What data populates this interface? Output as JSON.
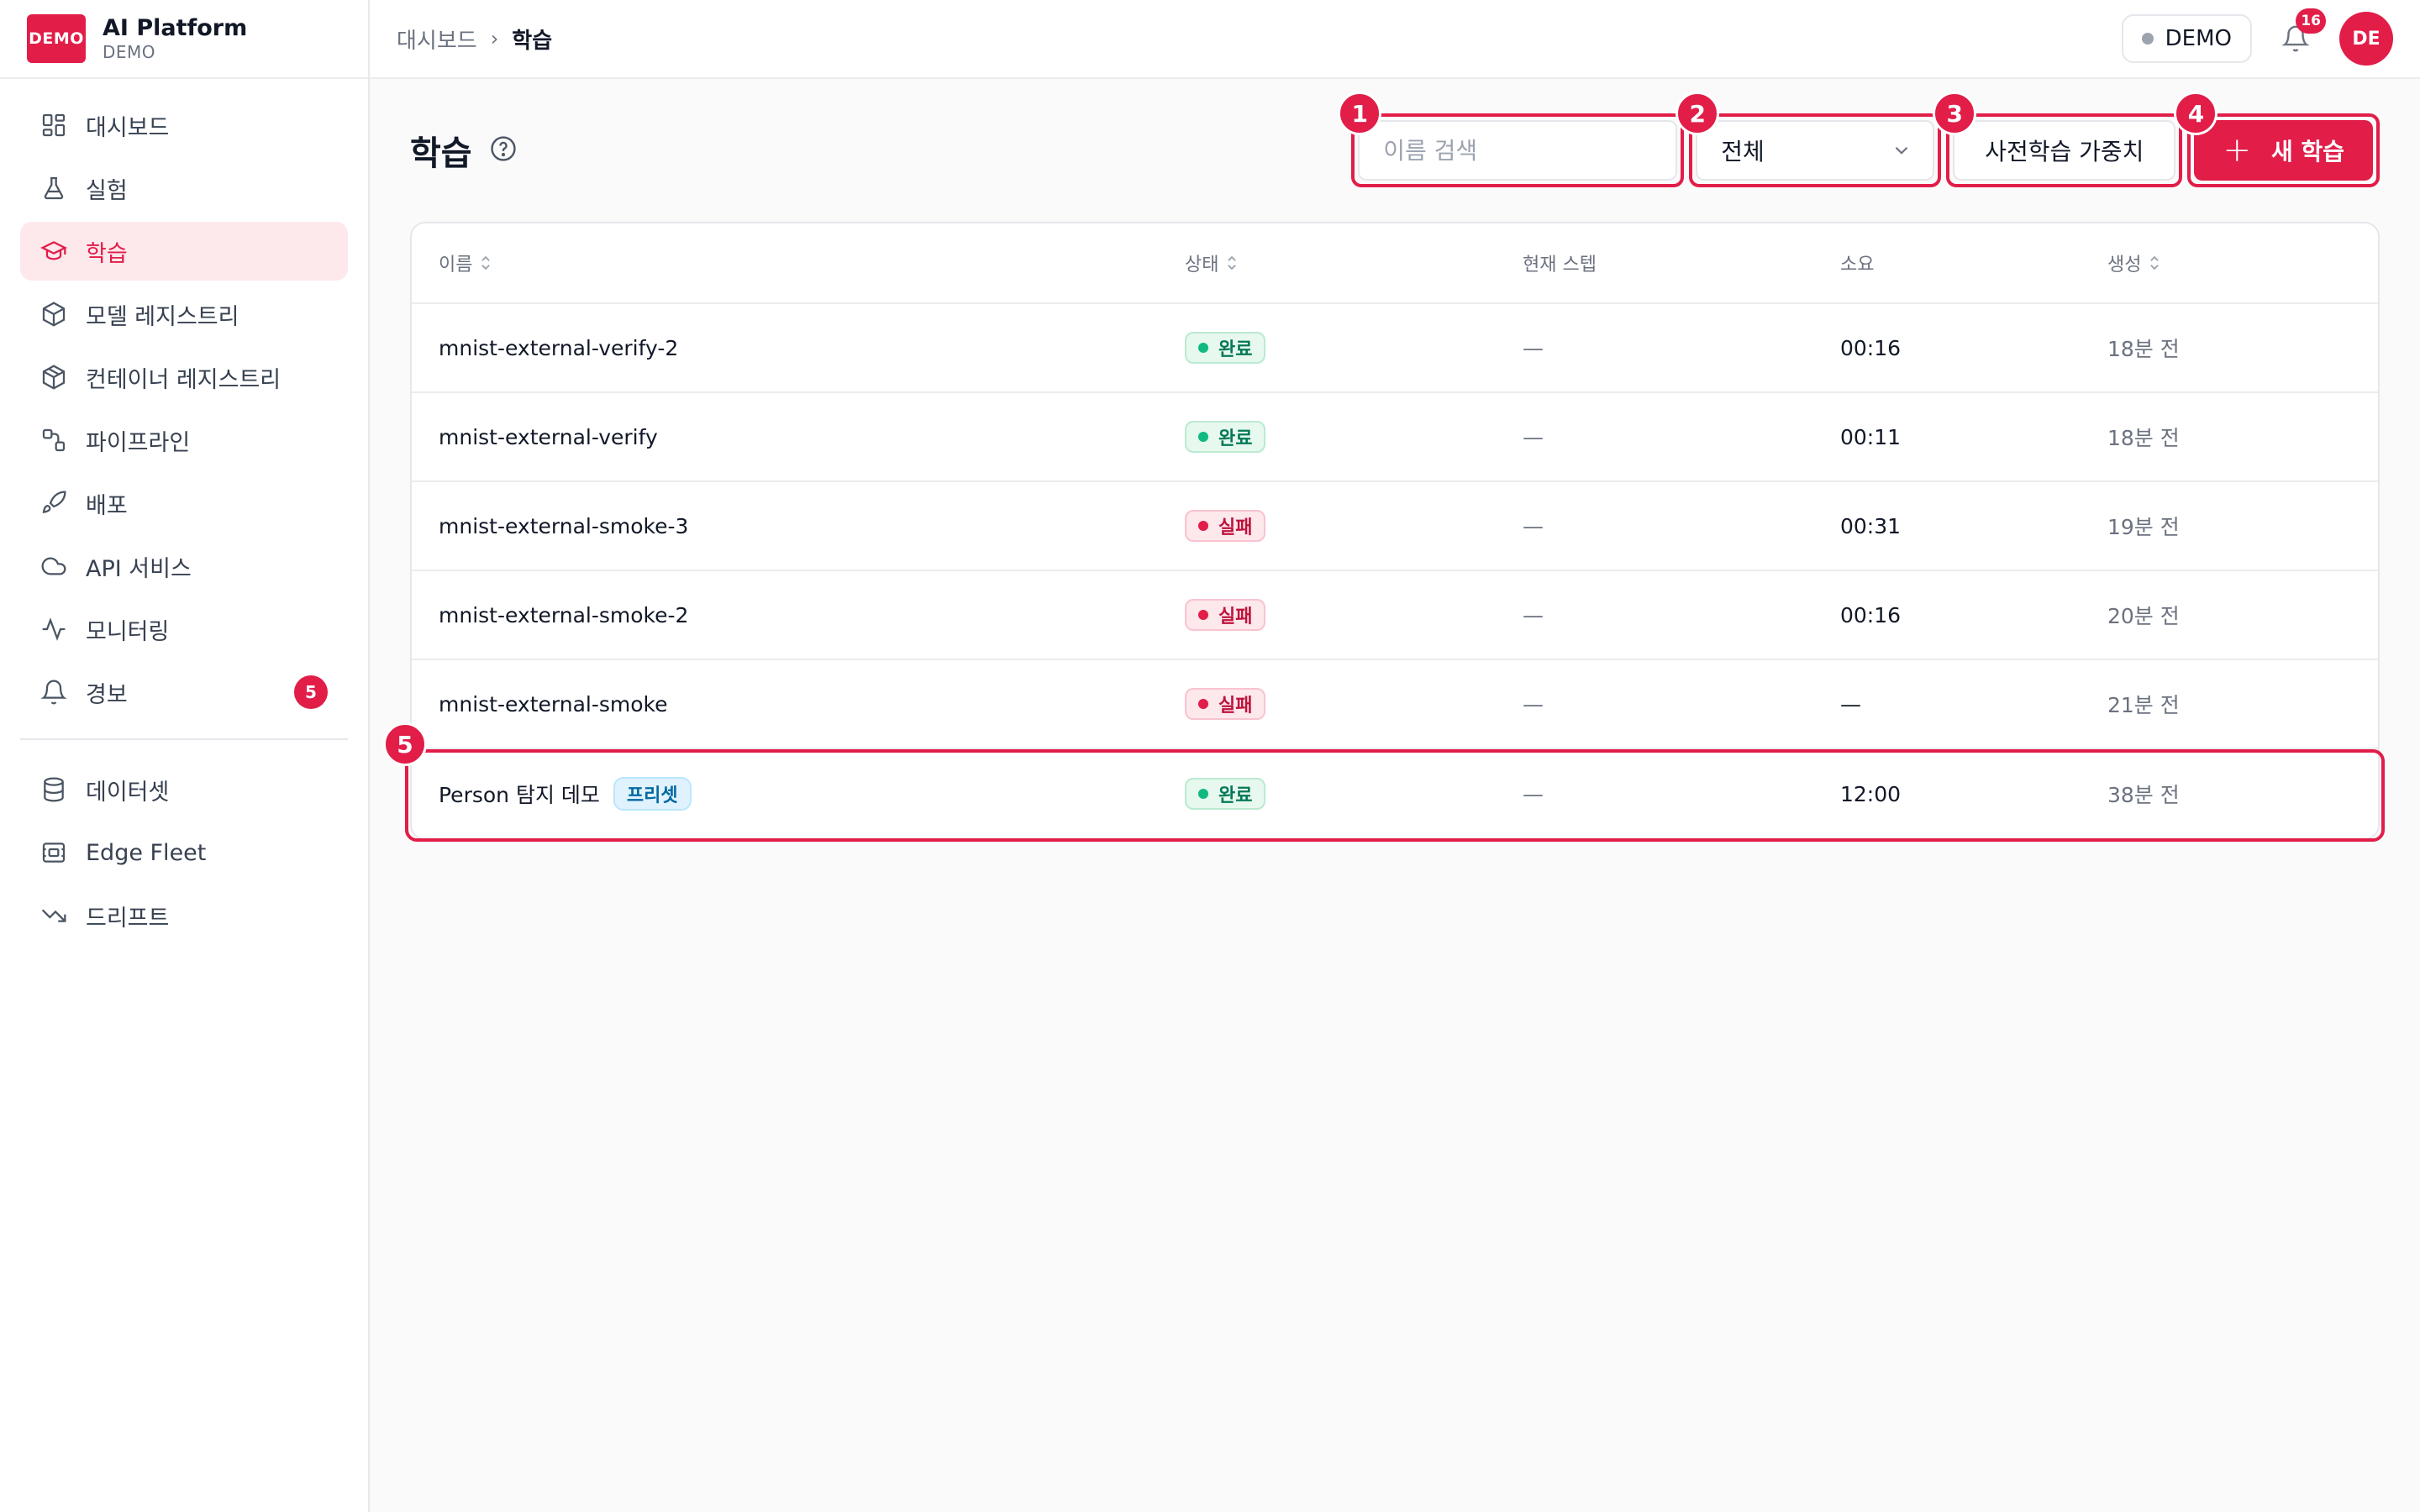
{
  "brand": {
    "logo": "DEMO",
    "title": "AI Platform",
    "subtitle": "DEMO"
  },
  "sidebar": {
    "items": [
      {
        "label": "대시보드",
        "icon": "dashboard-icon"
      },
      {
        "label": "실험",
        "icon": "flask-icon"
      },
      {
        "label": "학습",
        "icon": "graduation-cap-icon",
        "active": true
      },
      {
        "label": "모델 레지스트리",
        "icon": "cube-icon"
      },
      {
        "label": "컨테이너 레지스트리",
        "icon": "box-icon"
      },
      {
        "label": "파이프라인",
        "icon": "pipeline-icon"
      },
      {
        "label": "배포",
        "icon": "rocket-icon"
      },
      {
        "label": "API 서비스",
        "icon": "cloud-icon"
      },
      {
        "label": "모니터링",
        "icon": "activity-icon"
      },
      {
        "label": "경보",
        "icon": "bell-icon",
        "badge": "5"
      }
    ],
    "items2": [
      {
        "label": "데이터셋",
        "icon": "database-icon"
      },
      {
        "label": "Edge Fleet",
        "icon": "edge-device-icon"
      },
      {
        "label": "드리프트",
        "icon": "trending-down-icon"
      }
    ]
  },
  "topbar": {
    "breadcrumb": [
      "대시보드",
      "학습"
    ],
    "env": "DEMO",
    "notifications": "16",
    "avatar": "DE"
  },
  "page": {
    "title": "학습",
    "search_placeholder": "이름 검색",
    "filter_value": "전체",
    "pretrained_button": "사전학습 가중치",
    "new_button": "새 학습",
    "annotations": [
      "1",
      "2",
      "3",
      "4",
      "5"
    ]
  },
  "table": {
    "columns": [
      "이름",
      "상태",
      "현재 스텝",
      "소요",
      "생성"
    ],
    "rows": [
      {
        "name": "mnist-external-verify-2",
        "status": "완료",
        "status_kind": "done",
        "step": "—",
        "duration": "00:16",
        "created": "18분 전"
      },
      {
        "name": "mnist-external-verify",
        "status": "완료",
        "status_kind": "done",
        "step": "—",
        "duration": "00:11",
        "created": "18분 전"
      },
      {
        "name": "mnist-external-smoke-3",
        "status": "실패",
        "status_kind": "fail",
        "step": "—",
        "duration": "00:31",
        "created": "19분 전"
      },
      {
        "name": "mnist-external-smoke-2",
        "status": "실패",
        "status_kind": "fail",
        "step": "—",
        "duration": "00:16",
        "created": "20분 전"
      },
      {
        "name": "mnist-external-smoke",
        "status": "실패",
        "status_kind": "fail",
        "step": "—",
        "duration": "—",
        "created": "21분 전"
      },
      {
        "name": "Person 탐지 데모",
        "tag": "프리셋",
        "status": "완료",
        "status_kind": "done",
        "step": "—",
        "duration": "12:00",
        "created": "38분 전"
      }
    ]
  },
  "colors": {
    "accent": "#e11d48",
    "success": "#10b981",
    "preset": "#0369a1"
  }
}
